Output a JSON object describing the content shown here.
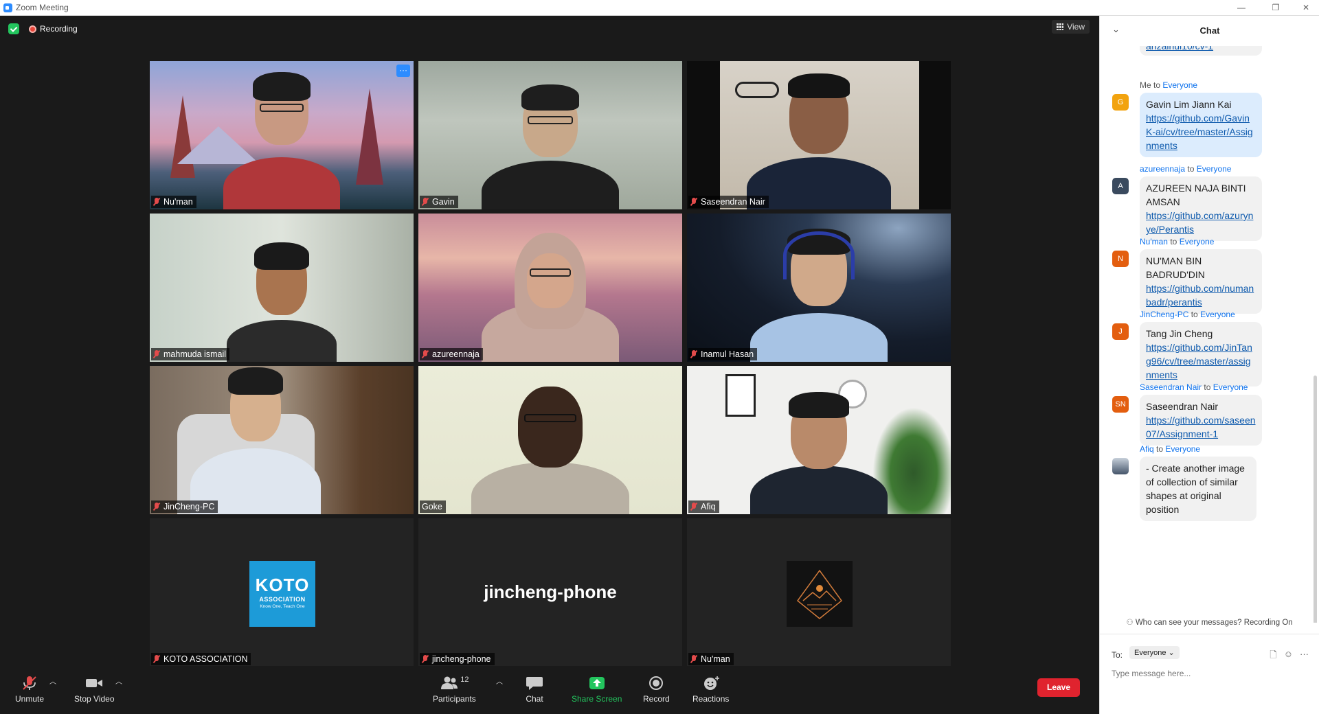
{
  "window": {
    "title": "Zoom Meeting"
  },
  "topbar": {
    "recording": "Recording",
    "view": "View"
  },
  "tiles": [
    {
      "name": "Nu'man"
    },
    {
      "name": "Gavin"
    },
    {
      "name": "Saseendran Nair"
    },
    {
      "name": "mahmuda ismail"
    },
    {
      "name": "azureennaja"
    },
    {
      "name": "Inamul Hasan"
    },
    {
      "name": "JinCheng-PC"
    },
    {
      "name": "Goke"
    },
    {
      "name": "Afiq"
    },
    {
      "name": "KOTO ASSOCIATION",
      "logo_text": "KOTO",
      "logo_sub": "ASSOCIATION",
      "logo_tag": "Know One, Teach One"
    },
    {
      "name": "jincheng-phone",
      "display": "jincheng-phone"
    },
    {
      "name": "Nu'man"
    }
  ],
  "toolbar": {
    "unmute": "Unmute",
    "stop_video": "Stop Video",
    "participants": "Participants",
    "participants_count": "12",
    "chat": "Chat",
    "share_screen": "Share Screen",
    "record": "Record",
    "reactions": "Reactions",
    "leave": "Leave"
  },
  "chat": {
    "title": "Chat",
    "partial_link": "anzainul10/cv-1",
    "messages": [
      {
        "from": "Me",
        "to_word": "to",
        "to": "Everyone",
        "initial": "G",
        "avatar_color": "#f2a30f",
        "text": "Gavin Lim Jiann Kai",
        "link": "https://github.com/GavinK-ai/cv/tree/master/Assignments",
        "me": true
      },
      {
        "from": "azureennaja",
        "to_word": "to",
        "to": "Everyone",
        "initial": "A",
        "avatar_color": "#3a4a5e",
        "text": "AZUREEN NAJA BINTI AMSAN",
        "link": "https://github.com/azurynye/Perantis"
      },
      {
        "from": "Nu'man",
        "to_word": "to",
        "to": "Everyone",
        "initial": "N",
        "avatar_color": "#e35e0f",
        "text": "NU'MAN BIN BADRUD'DIN",
        "link": "https://github.com/numanbadr/perantis"
      },
      {
        "from": "JinCheng-PC",
        "to_word": "to",
        "to": "Everyone",
        "initial": "J",
        "avatar_color": "#e35e0f",
        "text": "Tang Jin Cheng",
        "link": "https://github.com/JinTang96/cv/tree/master/assignments"
      },
      {
        "from": "Saseendran Nair",
        "to_word": "to",
        "to": "Everyone",
        "initial": "SN",
        "avatar_color": "#e35e0f",
        "text": "Saseendran Nair",
        "link": "https://github.com/saseen07/Assignment-1"
      },
      {
        "from": "Afiq",
        "to_word": "to",
        "to": "Everyone",
        "initial": "",
        "avatar_color": "#6b7a8c",
        "text": "- Create another image of collection of similar shapes at original position",
        "link": ""
      }
    ],
    "who_can_see": "Who can see your messages? Recording On",
    "to_label": "To:",
    "to_value": "Everyone",
    "input_placeholder": "Type message here..."
  }
}
